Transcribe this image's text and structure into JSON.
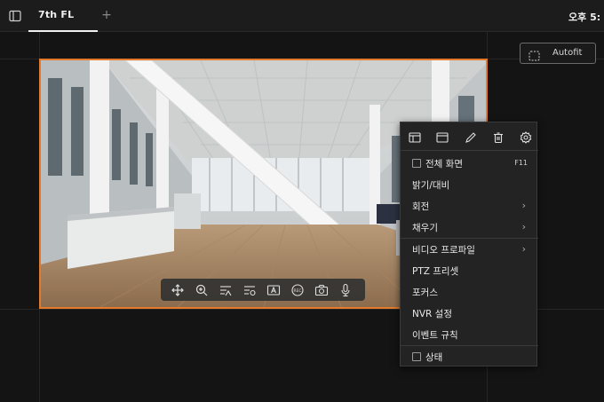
{
  "topbar": {
    "tab_label": "7th FL",
    "add_tab_symbol": "+",
    "clock": "오후 5:"
  },
  "autofit": {
    "label": "Autofit"
  },
  "video_toolbar": {
    "tools": [
      "move-icon",
      "zoom-in-icon",
      "image-adjust-icon",
      "settings-adjust-icon",
      "text-overlay-icon",
      "record-icon",
      "snapshot-icon",
      "microphone-icon"
    ]
  },
  "context_menu": {
    "icons": [
      "window-icon",
      "maximize-window-icon",
      "edit-icon",
      "delete-icon",
      "settings-icon"
    ],
    "fullscreen": {
      "label": "전체 화면",
      "shortcut": "F11"
    },
    "brightness": "밝기/대비",
    "rotate": "회전",
    "fill": "채우기",
    "video_profile": "비디오 프로파일",
    "ptz_preset": "PTZ 프리셋",
    "focus": "포커스",
    "nvr_settings": "NVR 설정",
    "event_rules": "이벤트 규칙",
    "status": "상태",
    "submenu_arrow": "›"
  },
  "colors": {
    "accent_border": "#e57a2a",
    "background": "#141414"
  }
}
